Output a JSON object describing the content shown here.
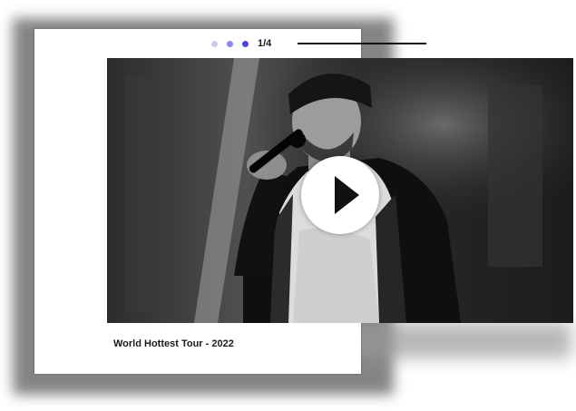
{
  "carousel": {
    "counter": "1/4",
    "dot_color": "#4747e8"
  },
  "video": {
    "caption": "World Hottest Tour - 2022",
    "play_icon": "play-icon",
    "image_description": "Black and white photo of a performer in a bandana and hoodie singing into a microphone"
  }
}
